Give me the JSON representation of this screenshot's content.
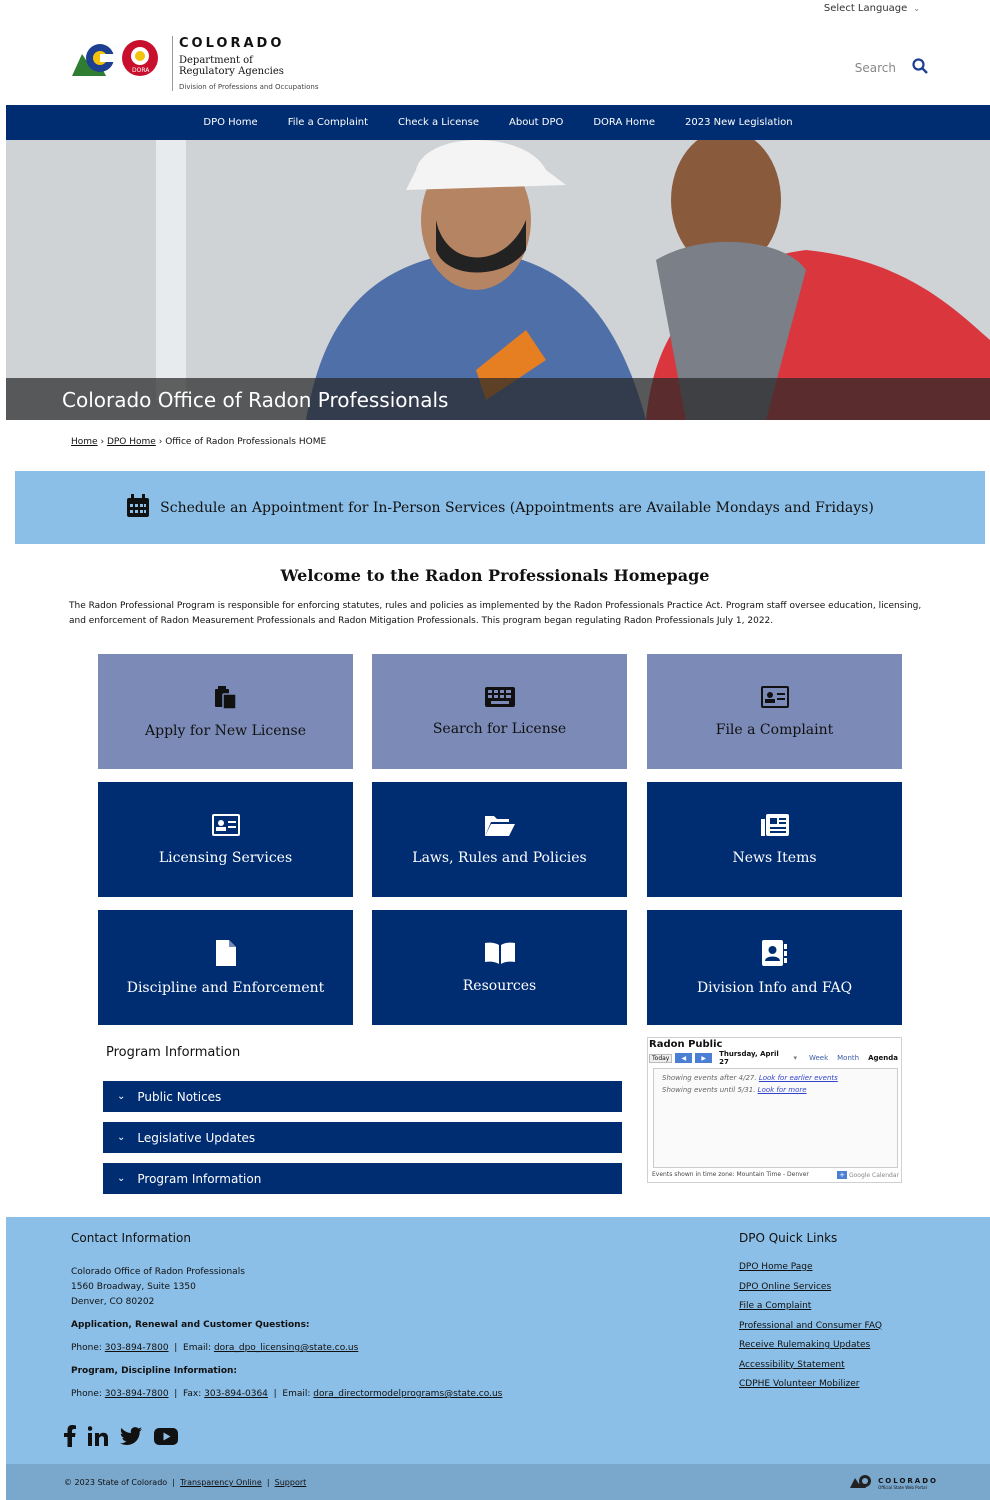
{
  "top": {
    "language_label": "Select Language"
  },
  "logo": {
    "state": "COLORADO",
    "dept": "Department of Regulatory Agencies",
    "badge": "DORA",
    "division": "Division of Professions and Occupations"
  },
  "search": {
    "placeholder": "Search"
  },
  "nav": {
    "items": [
      "DPO Home",
      "File a Complaint",
      "Check a License",
      "About DPO",
      "DORA Home",
      "2023 New Legislation"
    ]
  },
  "hero": {
    "title": "Colorado Office of Radon Professionals"
  },
  "breadcrumb": {
    "home": "Home",
    "dpo": "DPO Home",
    "current": "Office of Radon Professionals HOME",
    "sep": "›"
  },
  "appointment": {
    "text": "Schedule an Appointment for In-Person Services (Appointments are Available Mondays and Fridays)"
  },
  "welcome": {
    "heading": "Welcome to the Radon Professionals Homepage",
    "intro": "The Radon Professional Program is responsible for enforcing statutes, rules and policies as implemented by the Radon Professionals Practice Act. Program staff oversee education, licensing, and enforcement of Radon Measurement Professionals and Radon Mitigation Professionals. This program began regulating Radon Professionals July 1, 2022."
  },
  "tiles": [
    {
      "label": "Apply for New License",
      "icon": "clipboard-icon"
    },
    {
      "label": "Search for License",
      "icon": "keyboard-icon"
    },
    {
      "label": "File a Complaint",
      "icon": "id-card-icon"
    },
    {
      "label": "Licensing Services",
      "icon": "id-card-icon"
    },
    {
      "label": "Laws, Rules and Policies",
      "icon": "folder-open-icon"
    },
    {
      "label": "News Items",
      "icon": "newspaper-icon"
    },
    {
      "label": "Discipline and Enforcement",
      "icon": "file-icon"
    },
    {
      "label": "Resources",
      "icon": "book-open-icon"
    },
    {
      "label": "Division Info and FAQ",
      "icon": "address-book-icon"
    }
  ],
  "program": {
    "heading": "Program Information",
    "accordions": [
      "Public Notices",
      "Legislative Updates",
      "Program Information"
    ]
  },
  "calendar": {
    "title": "Radon Public",
    "today": "Today",
    "date": "Thursday, April 27",
    "views": [
      "Week",
      "Month",
      "Agenda"
    ],
    "line1_prefix": "Showing events after 4/27.",
    "line1_link": "Look for earlier events",
    "line2_prefix": "Showing events until 5/31.",
    "line2_link": "Look for more",
    "timezone": "Events shown in time zone: Mountain Time - Denver",
    "gcal": "Google Calendar"
  },
  "footer": {
    "contact_heading": "Contact Information",
    "org": "Colorado Office of Radon Professionals",
    "addr1": "1560 Broadway, Suite 1350",
    "addr2": "Denver, CO 80202",
    "app_heading": "Application, Renewal and Customer Questions:",
    "phone_label": "Phone:",
    "phone": "303-894-7800",
    "email_label": "Email:",
    "email1": "dora_dpo_licensing@state.co.us",
    "prog_heading": "Program, Discipline Information:",
    "fax_label": "Fax:",
    "fax": "303-894-0364",
    "email2": "dora_directormodelprograms@state.co.us",
    "links_heading": "DPO Quick Links",
    "links": [
      "DPO Home Page",
      "DPO Online Services",
      "File a Complaint",
      "Professional and Consumer FAQ",
      "Receive Rulemaking Updates",
      "Accessibility Statement",
      "CDPHE Volunteer Mobilizer"
    ],
    "copyright": "© 2023 State of Colorado",
    "transparency": "Transparency Online",
    "support": "Support",
    "portal_name": "COLORADO",
    "portal_sub": "Official State Web Portal"
  },
  "colors": {
    "navy": "#002d72",
    "lightblue": "#8cbfe7",
    "tile_light": "#7b8ab6"
  }
}
